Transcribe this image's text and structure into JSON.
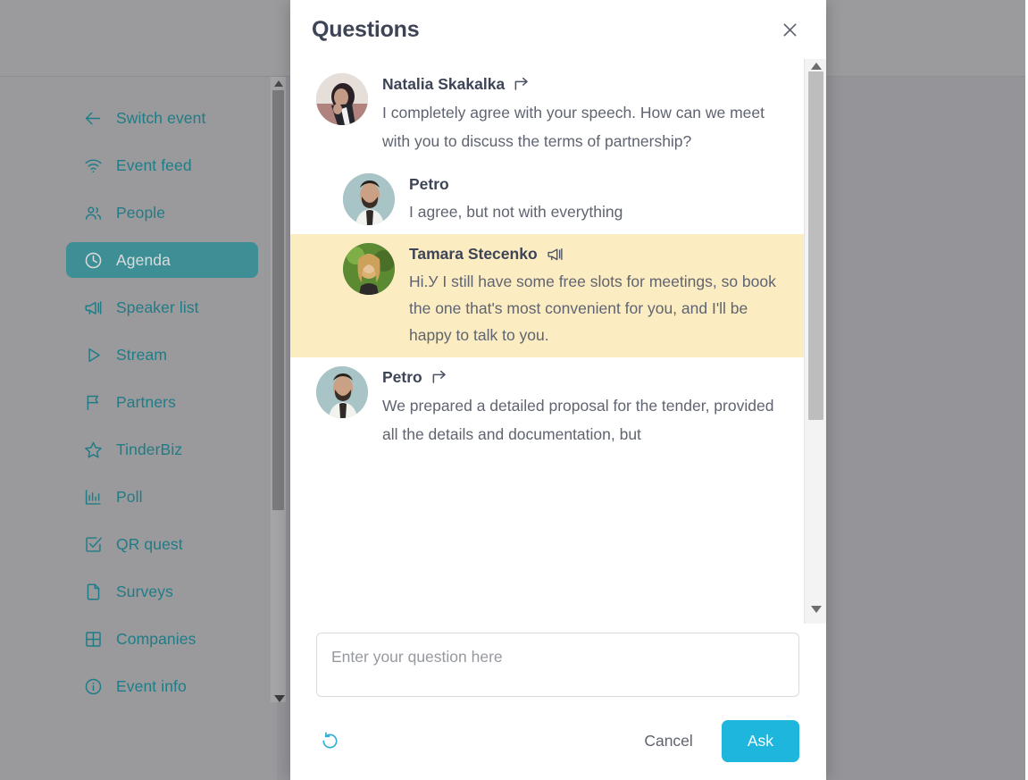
{
  "sidebar": {
    "items": [
      {
        "label": "Switch event",
        "icon": "arrow-left-icon",
        "active": false
      },
      {
        "label": "Event feed",
        "icon": "wifi-icon",
        "active": false
      },
      {
        "label": "People",
        "icon": "people-icon",
        "active": false
      },
      {
        "label": "Agenda",
        "icon": "clock-icon",
        "active": true
      },
      {
        "label": "Speaker list",
        "icon": "megaphone-icon",
        "active": false
      },
      {
        "label": "Stream",
        "icon": "play-icon",
        "active": false
      },
      {
        "label": "Partners",
        "icon": "flag-icon",
        "active": false
      },
      {
        "label": "TinderBiz",
        "icon": "star-icon",
        "active": false
      },
      {
        "label": "Poll",
        "icon": "bar-chart-icon",
        "active": false
      },
      {
        "label": "QR quest",
        "icon": "check-square-icon",
        "active": false
      },
      {
        "label": "Surveys",
        "icon": "document-icon",
        "active": false
      },
      {
        "label": "Companies",
        "icon": "grid-icon",
        "active": false
      },
      {
        "label": "Event info",
        "icon": "info-icon",
        "active": false
      }
    ]
  },
  "modal": {
    "title": "Questions",
    "close_icon": "close-icon",
    "messages": [
      {
        "name": "Natalia Skakalka",
        "text": "I completely agree with your speech. How can we meet with you to discuss the terms of partnership?",
        "badge": "forward-arrow-icon",
        "reply": false,
        "highlight": false,
        "avatar": "woman-dark-hair-avatar"
      },
      {
        "name": "Petro",
        "text": "I agree, but not with everything",
        "badge": "",
        "reply": true,
        "highlight": false,
        "avatar": "man-beard-avatar"
      },
      {
        "name": "Tamara Stecenko",
        "text": "Hi.У I still have some free slots for meetings, so book the one that's most convenient for you, and I'll be happy to talk to you.",
        "badge": "megaphone-icon",
        "reply": true,
        "highlight": true,
        "avatar": "woman-blonde-avatar"
      },
      {
        "name": "Petro",
        "text": "We prepared a detailed proposal for the tender, provided all the details and documentation, but",
        "badge": "forward-arrow-icon",
        "reply": false,
        "highlight": false,
        "avatar": "man-beard-avatar"
      }
    ],
    "input": {
      "placeholder": "Enter your question here",
      "value": ""
    },
    "footer": {
      "refresh_icon": "refresh-icon",
      "cancel_label": "Cancel",
      "ask_label": "Ask"
    }
  },
  "colors": {
    "accent_teal": "#1f7c86",
    "active_item": "#3d8e95",
    "highlight_bg": "#fbecc2",
    "ask_button": "#1fb6dd",
    "title_text": "#3d4456"
  }
}
